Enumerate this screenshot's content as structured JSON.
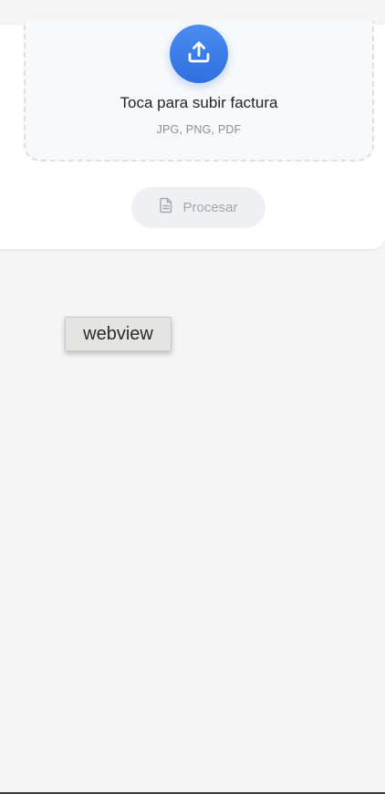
{
  "upload": {
    "title": "Toca para subir factura",
    "formats": "JPG, PNG, PDF",
    "icon": "upload-icon",
    "accent": "#3b7ee8"
  },
  "process_button": {
    "label": "Procesar",
    "icon": "document-icon",
    "enabled": false
  },
  "overlay": {
    "label": "webview"
  }
}
